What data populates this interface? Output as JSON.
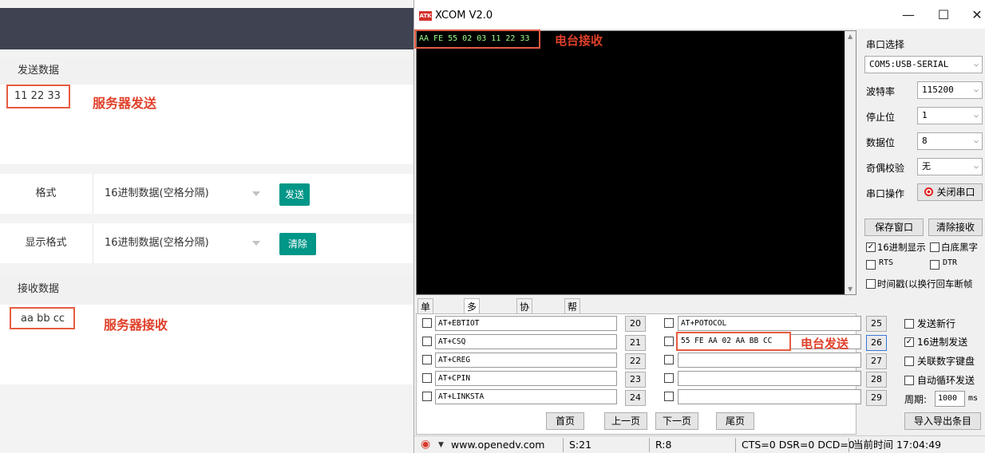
{
  "left_panel": {
    "send_section_title": "发送数据",
    "send_value": "11 22 33",
    "server_send_annotation": "服务器发送",
    "format_label": "格式",
    "format_value": "16进制数据(空格分隔)",
    "send_button": "发送",
    "display_format_label": "显示格式",
    "display_format_value": "16进制数据(空格分隔)",
    "clear_button": "清除",
    "receive_section_title": "接收数据",
    "receive_value": "aa bb cc",
    "server_receive_annotation": "服务器接收"
  },
  "xcom": {
    "icon_text": "ATK",
    "title": "XCOM V2.0",
    "window_controls": {
      "minimize": "—",
      "maximize": "☐",
      "close": "✕"
    },
    "receive_text": "AA FE 55 02 03 11 22 33",
    "radio_receive_annotation": "电台接收",
    "radio_send_annotation": "电台发送",
    "settings": {
      "port_select_label": "串口选择",
      "port_value": "COM5:USB-SERIAL",
      "baud_label": "波特率",
      "baud_value": "115200",
      "stop_bits_label": "停止位",
      "stop_bits_value": "1",
      "data_bits_label": "数据位",
      "data_bits_value": "8",
      "parity_label": "奇偶校验",
      "parity_value": "无",
      "port_op_label": "串口操作",
      "close_port_button": "关闭串口",
      "save_window_button": "保存窗口",
      "clear_receive_button": "清除接收",
      "hex_display_label": "16进制显示",
      "white_bg_label": "白底黑字",
      "rts_label": "RTS",
      "dtr_label": "DTR",
      "timestamp_label": "时间戳(以换行回车断帧"
    },
    "tabs": [
      "单条发送",
      "多条发送",
      "协议传输",
      "帮助"
    ],
    "multi_send": {
      "left_rows": [
        {
          "text": "AT+EBTIOT",
          "num": "20"
        },
        {
          "text": "AT+CSQ",
          "num": "21"
        },
        {
          "text": "AT+CREG",
          "num": "22"
        },
        {
          "text": "AT+CPIN",
          "num": "23"
        },
        {
          "text": "AT+LINKSTA",
          "num": "24"
        }
      ],
      "right_rows": [
        {
          "text": "AT+POTOCOL",
          "num": "25"
        },
        {
          "text": "55 FE AA 02 AA BB CC",
          "num": "26"
        },
        {
          "text": "",
          "num": "27"
        },
        {
          "text": "",
          "num": "28"
        },
        {
          "text": "",
          "num": "29"
        }
      ],
      "options": {
        "send_newline": "发送新行",
        "hex_send": "16进制发送",
        "link_keyboard": "关联数字键盘",
        "auto_loop": "自动循环发送",
        "period_label": "周期:",
        "period_value": "1000",
        "period_unit": "ms"
      },
      "pager": [
        "首页",
        "上一页",
        "下一页",
        "尾页"
      ],
      "import_export_button": "导入导出条目"
    },
    "status_bar": {
      "website": "www.openedv.com",
      "sent": "S:21",
      "received": "R:8",
      "lines": "CTS=0 DSR=0 DCD=0",
      "time": "当前时间 17:04:49"
    }
  }
}
